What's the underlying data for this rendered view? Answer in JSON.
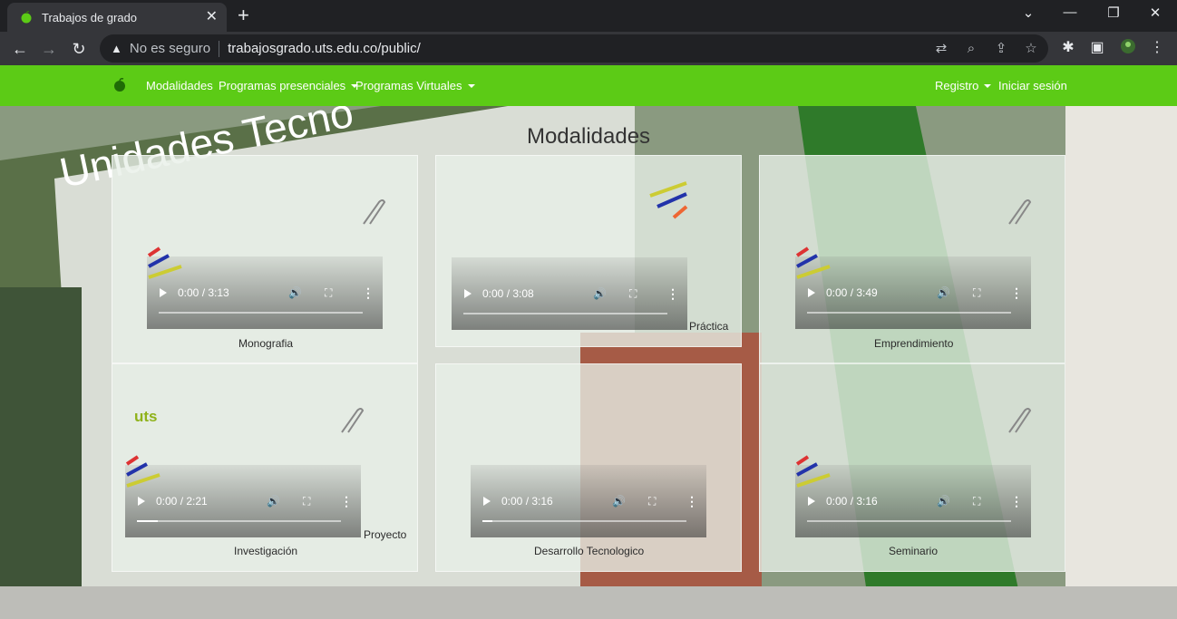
{
  "browser": {
    "tab_title": "Trabajos de grado",
    "tab_close": "✕",
    "new_tab": "+",
    "security_text": "No es seguro",
    "url": "trabajosgrado.uts.edu.co/public/"
  },
  "navbar": {
    "links": [
      {
        "label": "Modalidades"
      },
      {
        "label": "Programas presenciales"
      },
      {
        "label": "Programas Virtuales"
      }
    ],
    "right": [
      {
        "label": "Registro"
      },
      {
        "label": "Iniciar sesión"
      }
    ]
  },
  "page": {
    "title": "Modalidades",
    "cards": [
      {
        "label": "Monografia",
        "time": "0:00 / 3:13",
        "progress": 0
      },
      {
        "label": "Práctica",
        "time": "0:00 / 3:08",
        "progress": 0
      },
      {
        "label": "Emprendimiento",
        "time": "0:00 / 3:49",
        "progress": 0
      },
      {
        "label": "Investigación",
        "time": "0:00 / 2:21",
        "progress": 0.1
      },
      {
        "label": "Proyecto",
        "time": "",
        "progress": 0
      },
      {
        "label": "Desarrollo Tecnologico",
        "time": "0:00 / 3:16",
        "progress": 0.05
      },
      {
        "label": "Seminario",
        "time": "0:00 / 3:16",
        "progress": 0
      }
    ],
    "video_icons": {
      "play": "play-icon",
      "volume": "🔊",
      "fullscreen": "⛶",
      "more": "⋮"
    },
    "logo_text": "uts"
  },
  "colors": {
    "nav_green": "#5ccb16",
    "card_bg": "#e8f0e8"
  }
}
